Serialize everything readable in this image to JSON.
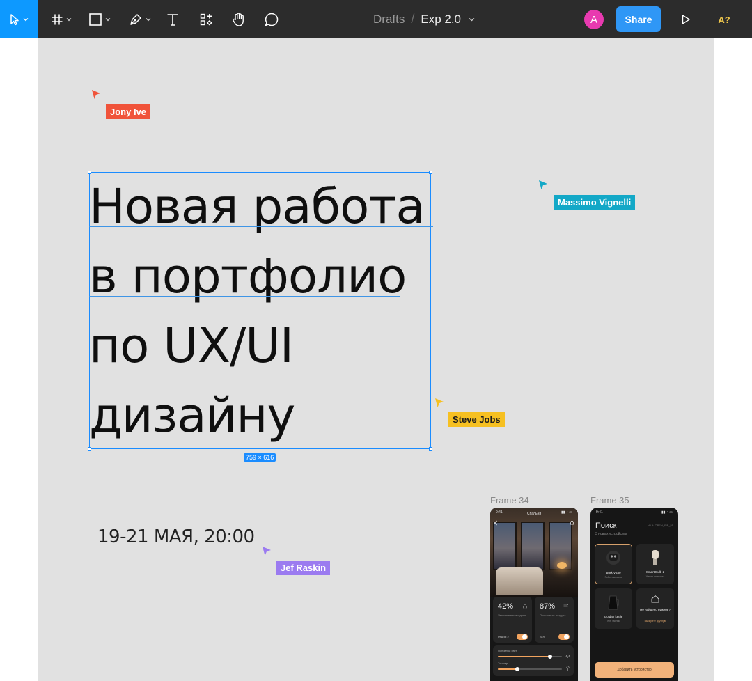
{
  "toolbar": {
    "tools": [
      {
        "name": "move",
        "has_menu": true,
        "active": true
      },
      {
        "name": "frame",
        "has_menu": true
      },
      {
        "name": "shape",
        "has_menu": true
      },
      {
        "name": "pen",
        "has_menu": true
      },
      {
        "name": "text"
      },
      {
        "name": "resources"
      },
      {
        "name": "hand"
      },
      {
        "name": "comment"
      }
    ],
    "breadcrumb": {
      "project": "Drafts",
      "separator": "/",
      "file": "Exp 2.0"
    },
    "avatar_initial": "A",
    "share_label": "Share",
    "a11y_label": "A?",
    "accent_color": "#0d99ff"
  },
  "canvas": {
    "cursors": [
      {
        "name": "Jony Ive",
        "color": "#f0533a"
      },
      {
        "name": "Massimo Vignelli",
        "color": "#13a8c7"
      },
      {
        "name": "Steve Jobs",
        "color": "#f6c021"
      },
      {
        "name": "Jef Raskin",
        "color": "#9b7bf0"
      }
    ],
    "headline_lines": [
      "Новая работа",
      "в портфолио",
      "по UX/UI",
      "дизайну"
    ],
    "selection_size": "759 × 616",
    "date_text": "19-21 МАЯ, 20:00"
  },
  "frames": {
    "frame34": {
      "label": "Frame 34",
      "time": "9:41",
      "room_title": "Спальня",
      "cards": [
        {
          "value": "42%",
          "sub": "Увлажнитель воздуха",
          "foot": "Режим 2"
        },
        {
          "value": "87%",
          "sub": "Очиститель воздуха",
          "foot": "Вкл"
        }
      ],
      "sliders": [
        {
          "label": "Основной свет",
          "level": 0.82
        },
        {
          "label": "Торшер",
          "level": 0.3
        }
      ]
    },
    "frame35": {
      "label": "Frame 35",
      "time": "9:41",
      "title": "Поиск",
      "subtitle": "3 новых устройства",
      "wifi": "Wi-fi: OPEN_FIB_55",
      "devices": [
        {
          "name": "Bork V530",
          "sub": "Робот-пылесос",
          "selected": true
        },
        {
          "name": "Smart Bulb-2",
          "sub": "Умная лампочка"
        },
        {
          "name": "Goldair kettle",
          "sub": "Wifi чайник"
        },
        {
          "name": "Не найдено нужное?",
          "link": "Выберите вручную"
        }
      ],
      "add_button": "Добавить устройство"
    }
  }
}
